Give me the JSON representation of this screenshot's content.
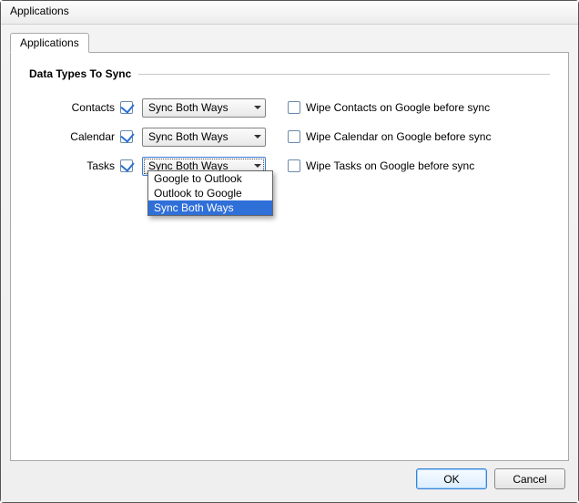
{
  "window": {
    "title": "Applications"
  },
  "tabs": [
    {
      "label": "Applications"
    }
  ],
  "section": {
    "title": "Data Types To Sync"
  },
  "rows": {
    "contacts": {
      "label": "Contacts",
      "checked": true,
      "combo_value": "Sync Both Ways",
      "wipe_checked": false,
      "wipe_label": "Wipe Contacts on Google before sync"
    },
    "calendar": {
      "label": "Calendar",
      "checked": true,
      "combo_value": "Sync Both Ways",
      "wipe_checked": false,
      "wipe_label": "Wipe Calendar on Google before sync"
    },
    "tasks": {
      "label": "Tasks",
      "checked": true,
      "combo_value": "Sync Both Ways",
      "wipe_checked": false,
      "wipe_label": "Wipe Tasks on Google before sync",
      "dropdown_open": true,
      "options": [
        {
          "label": "Google to Outlook",
          "selected": false
        },
        {
          "label": "Outlook to Google",
          "selected": false
        },
        {
          "label": "Sync Both Ways",
          "selected": true
        }
      ]
    }
  },
  "buttons": {
    "ok": "OK",
    "cancel": "Cancel"
  }
}
